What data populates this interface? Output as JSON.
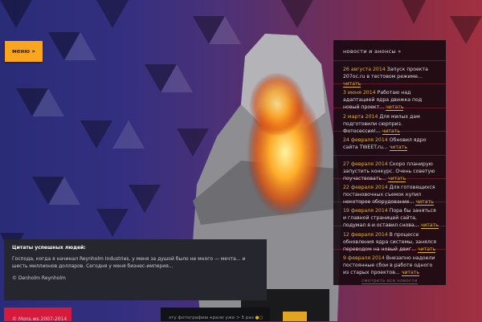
{
  "menu": {
    "label": "меню »"
  },
  "news": {
    "title": "новости и анонсы »",
    "more_label": "читать",
    "items": [
      {
        "date": "26 августа 2014",
        "text": "Запуск проекта 207ос.ru в тестовом режиме..."
      },
      {
        "date": "3 июня 2014",
        "text": "Работаю над адаптацией ядра движка под новый проект..."
      },
      {
        "date": "2 марта 2014",
        "text": "Для милых дам подготовили сюрприз. Фотосессия!..."
      },
      {
        "date": "24 февраля 2014",
        "text": "Обновил ядро сайта TWEET.ru..."
      },
      {
        "date": "27 февраля 2014",
        "text": "Скоро планирую запустить конкурс. Очень советую поучаствовать..."
      },
      {
        "date": "22 февраля 2014",
        "text": "Для готовящихся постановочных съемок купил некоторое оборудование..."
      },
      {
        "date": "19 февраля 2014",
        "text": "Пора бы заняться и главной страницей сайта, подумал я и оставил снова..."
      },
      {
        "date": "12 февраля 2014",
        "text": "В процессе обновления ядра системы, занялся переводом на новый двиг..."
      },
      {
        "date": "9 февраля 2014",
        "text": "Внезапно надоели постоянные сбои в работе одного из старых проектов..."
      }
    ],
    "all_label": "смотреть все новости"
  },
  "quote": {
    "title": "Цитаты успешных людей:",
    "text": "Господа, когда я начинал Reynholm Industries, у меня за душой было не много — мечта... и шесть миллионов долларов. Сегодня у меня бизнес-империя...",
    "author": "© Denholm Reynholm"
  },
  "footer": {
    "copyright": "© Mons.ws 2007-2014",
    "photo_note": "эту фотографию крали уже > 5 раз"
  },
  "colors": {
    "accent": "#f9a51e",
    "date": "#e3b422",
    "footer_red": "#d51a3c"
  }
}
